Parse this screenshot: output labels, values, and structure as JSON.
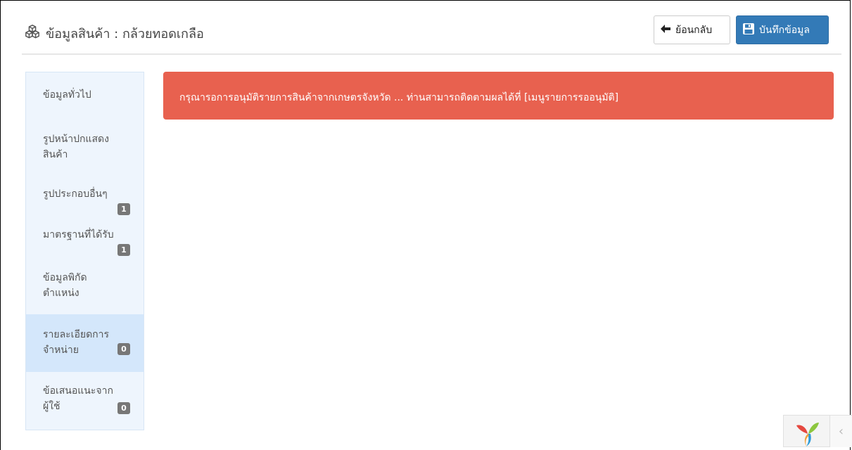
{
  "header": {
    "title": "ข้อมูลสินค้า : กล้วยทอดเกลือ",
    "back_label": "ย้อนกลับ",
    "save_label": "บันทึกข้อมูล"
  },
  "sidebar": {
    "items": [
      {
        "label_lines": [
          "ข้อมูลทั่วไป"
        ],
        "badge": null
      },
      {
        "label_lines": [
          "รูปหน้าปกแสดง",
          "สินค้า"
        ],
        "badge": null
      },
      {
        "label_lines": [
          "รูปประกอบอื่นๆ"
        ],
        "badge": "1"
      },
      {
        "label_lines": [
          "มาตรฐานที่ได้รับ"
        ],
        "badge": "1"
      },
      {
        "label_lines": [
          "ข้อมูลพิกัด",
          "ตำแหน่ง"
        ],
        "badge": null
      },
      {
        "label_lines": [
          "รายละเอียดการ",
          "จำหน่าย"
        ],
        "badge": "0",
        "active": true
      },
      {
        "label_lines": [
          "ข้อเสนอแนะจาก",
          "ผู้ใช้"
        ],
        "badge": "0"
      }
    ]
  },
  "alert": {
    "message": "กรุณารอการอนุมัติรายการสินค้าจากเกษตรจังหวัด ... ท่านสามารถติดตามผลได้ที่ [เมนูรายการรออนุมัติ]"
  },
  "colors": {
    "primary": "#337ab7",
    "danger": "#e8614f",
    "sidebar_bg": "#eef5fd",
    "sidebar_active": "#d4e7fb",
    "badge": "#777777"
  },
  "icons": {
    "title": "cubes-icon",
    "back": "arrow-left-icon",
    "save": "save-icon",
    "corner": "yii-logo-icon",
    "corner_toggle": "chevron-left-icon"
  }
}
